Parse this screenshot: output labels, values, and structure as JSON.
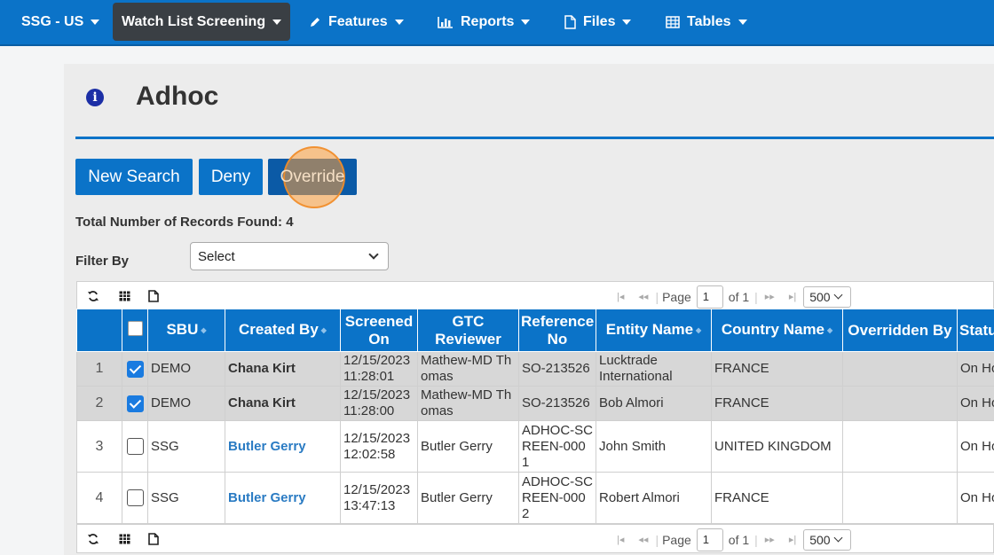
{
  "nav": {
    "brand": "SSG - US",
    "items": [
      {
        "label": "Watch List Screening",
        "icon": ""
      },
      {
        "label": "Features",
        "icon": "pencil-icon"
      },
      {
        "label": "Reports",
        "icon": "bar-chart-icon"
      },
      {
        "label": "Files",
        "icon": "file-icon"
      },
      {
        "label": "Tables",
        "icon": "table-icon"
      }
    ]
  },
  "page": {
    "title": "Adhoc",
    "records_label": "Total Number of Records Found: 4",
    "filter_label": "Filter By",
    "filter_value": "Select"
  },
  "buttons": {
    "new_search": "New Search",
    "deny": "Deny",
    "override": "Override"
  },
  "pager": {
    "page_label": "Page",
    "page_value": "1",
    "of_label": "of 1",
    "page_size": "500"
  },
  "table": {
    "columns": [
      "SBU",
      "Created By",
      "Screened On",
      "GTC Reviewer",
      "Reference No",
      "Entity Name",
      "Country Name",
      "Overridden By",
      "Status"
    ],
    "rows": [
      {
        "num": "1",
        "checked": true,
        "sbu": "DEMO",
        "created_by": "Chana Kirt",
        "screened_on": "12/15/2023 11:28:01",
        "reviewer": "Mathew-MD Thomas",
        "reference": "SO-213526",
        "entity": "Lucktrade International",
        "country": "FRANCE",
        "overridden_by": "",
        "status": "On Hold"
      },
      {
        "num": "2",
        "checked": true,
        "sbu": "DEMO",
        "created_by": "Chana Kirt",
        "screened_on": "12/15/2023 11:28:00",
        "reviewer": "Mathew-MD Thomas",
        "reference": "SO-213526",
        "entity": "Bob Almori",
        "country": "FRANCE",
        "overridden_by": "",
        "status": "On Hold"
      },
      {
        "num": "3",
        "checked": false,
        "sbu": "SSG",
        "created_by": "Butler Gerry",
        "screened_on": "12/15/2023 12:02:58",
        "reviewer": "Butler Gerry",
        "reference": "ADHOC-SCREEN-0001",
        "entity": "John Smith",
        "country": "UNITED KINGDOM",
        "overridden_by": "",
        "status": "On Hold"
      },
      {
        "num": "4",
        "checked": false,
        "sbu": "SSG",
        "created_by": "Butler Gerry",
        "screened_on": "12/15/2023 13:47:13",
        "reviewer": "Butler Gerry",
        "reference": "ADHOC-SCREEN-0002",
        "entity": "Robert Almori",
        "country": "FRANCE",
        "overridden_by": "",
        "status": "On Hold"
      }
    ]
  }
}
